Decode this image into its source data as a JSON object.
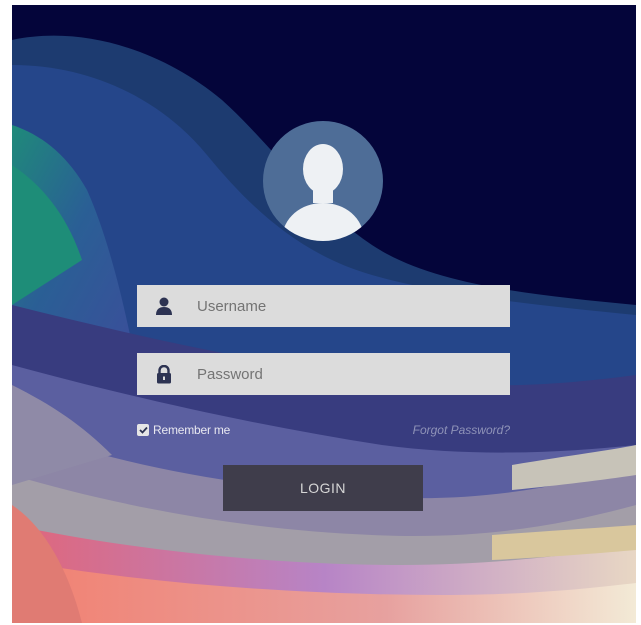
{
  "login": {
    "username_placeholder": "Username",
    "password_placeholder": "Password",
    "remember_label": "Remember me",
    "remember_checked": true,
    "forgot_label": "Forgot Password?",
    "login_label": "LOGIN"
  },
  "icons": {
    "avatar": "user-silhouette-icon",
    "username": "user-icon",
    "password": "lock-icon",
    "checkbox": "checkmark-icon"
  },
  "colors": {
    "background_dark": "#04053a",
    "field_bg": "#dcdcdc",
    "icon_color": "#2d3352",
    "button_bg": "#3f3d4b",
    "avatar_bg": "#4e6d97"
  }
}
